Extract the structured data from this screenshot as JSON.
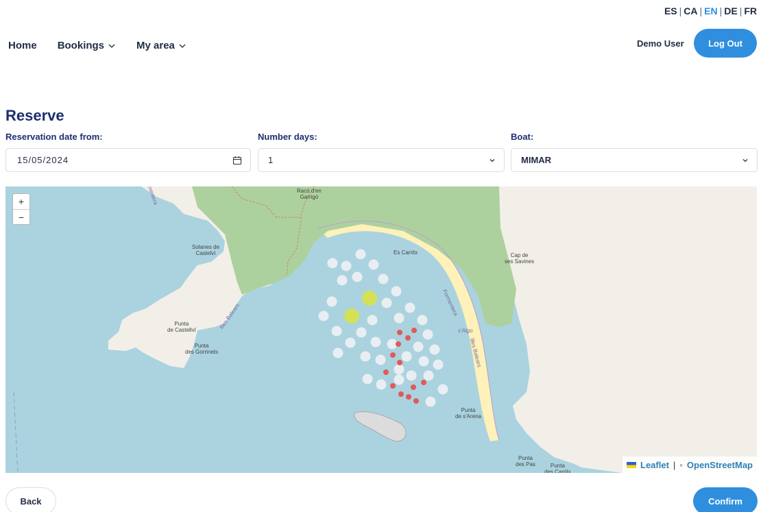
{
  "languages": [
    {
      "code": "ES",
      "active": false
    },
    {
      "code": "CA",
      "active": false
    },
    {
      "code": "EN",
      "active": true
    },
    {
      "code": "DE",
      "active": false
    },
    {
      "code": "FR",
      "active": false
    }
  ],
  "nav": {
    "home": "Home",
    "bookings": "Bookings",
    "my_area": "My area"
  },
  "user": {
    "name": "Demo User",
    "logout": "Log Out"
  },
  "page": {
    "title": "Reserve"
  },
  "form": {
    "date_label": "Reservation date from:",
    "date_value": "15/05/2024",
    "days_label": "Number days:",
    "days_value": "1",
    "boat_label": "Boat:",
    "boat_value": "MIMAR"
  },
  "map": {
    "zoom_in": "+",
    "zoom_out": "−",
    "labels": {
      "raco": "Racó d'en\nGarrigó",
      "solanes": "Solanes de\nCastelví",
      "es_carritx": "Es Carritx",
      "cap_savines": "Cap de\nses Savines",
      "punta_castellvi": "Punta\nde Castellví",
      "punta_gorrinets": "Punta\ndes Gorrinets",
      "illes_balears_left": "Illes Balears",
      "formentera_road": "Formentera",
      "algo": "s'Algo",
      "illes_balears_right": "Illes Balears",
      "punta_arena": "Punta\nde s'Arena",
      "punta_pas": "Punta\ndes Pas",
      "punta_carritx": "Punta\ndes Carritx",
      "formentera_corner": "mentera"
    },
    "attribution_leaflet": "Leaflet",
    "attribution_osm": "OpenStreetMap",
    "colors": {
      "water": "#aad3df",
      "land": "#f2efe9",
      "forest": "#add19e",
      "beach": "#fff1ba",
      "mooring_free": "#e9eef2",
      "mooring_selected": "#d4e157",
      "mooring_occupied": "#e05a5a"
    }
  },
  "actions": {
    "back": "Back",
    "confirm": "Confirm"
  }
}
